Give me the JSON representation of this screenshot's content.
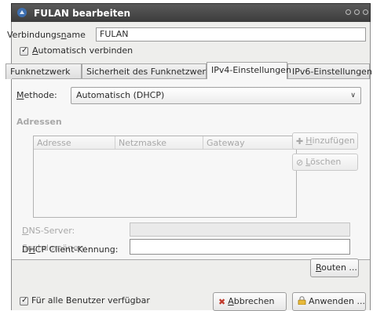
{
  "window": {
    "title": "FULAN bearbeiten"
  },
  "connection_name": {
    "label_prefix": "Verbindungs",
    "label_underlined": "n",
    "label_suffix": "ame",
    "value": "FULAN"
  },
  "auto_connect": {
    "checked": true,
    "label_underlined": "A",
    "label_rest": "utomatisch verbinden"
  },
  "tabs": [
    {
      "label": "Funknetzwerk"
    },
    {
      "label": "Sicherheit des Funknetzwerks"
    },
    {
      "label": "IPv4-Einstellungen",
      "active": true
    },
    {
      "label": "IPv6-Einstellungen"
    }
  ],
  "ipv4": {
    "method_label_underlined": "M",
    "method_label_rest": "ethode:",
    "method_value": "Automatisch (DHCP)",
    "addresses_heading": "Adressen",
    "columns": [
      "Adresse",
      "Netzmaske",
      "Gateway"
    ],
    "add_label_underlined": "H",
    "add_label_rest": "inzufügen",
    "delete_label_underlined": "L",
    "delete_label_rest": "öschen",
    "dns_label_underlined": "D",
    "dns_label_rest": "NS-Server:",
    "search_label_underlined": "S",
    "search_label_rest": "uchdomänen:",
    "dhcp_label_prefix": "D",
    "dhcp_label_underlined": "H",
    "dhcp_label_rest": "CP Client-Kennung:",
    "routes_label_underlined": "R",
    "routes_label_rest": "outen ..."
  },
  "footer": {
    "all_users_checked": true,
    "all_users_label": "Für alle Benutzer verfügbar",
    "cancel_label_underlined": "A",
    "cancel_label_rest": "bbrechen",
    "apply_label": "Anwenden ..."
  },
  "icons": {
    "app": "network-connection-icon",
    "cancel": "x-icon",
    "apply": "lock-icon",
    "add": "plus-icon",
    "delete": "delete-icon"
  }
}
